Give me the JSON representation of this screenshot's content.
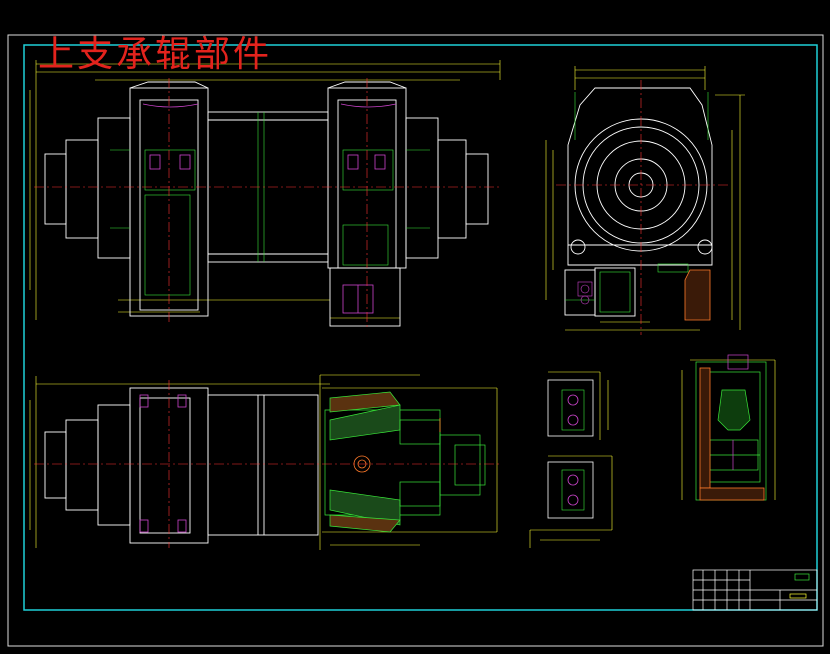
{
  "drawing": {
    "title": "上支承辊部件",
    "colors": {
      "background": "#000000",
      "frame": "#1fd0d8",
      "main_outline": "#ffffff",
      "dimension": "#ffff33",
      "part_line": "#39e639",
      "center_line": "#ff3333",
      "hidden": "#cc44cc",
      "title": "#e3231d"
    },
    "views": [
      {
        "name": "front-view"
      },
      {
        "name": "side-view"
      },
      {
        "name": "top-section-view"
      },
      {
        "name": "detail-view-b"
      },
      {
        "name": "detail-view-c"
      },
      {
        "name": "title-block"
      }
    ]
  }
}
